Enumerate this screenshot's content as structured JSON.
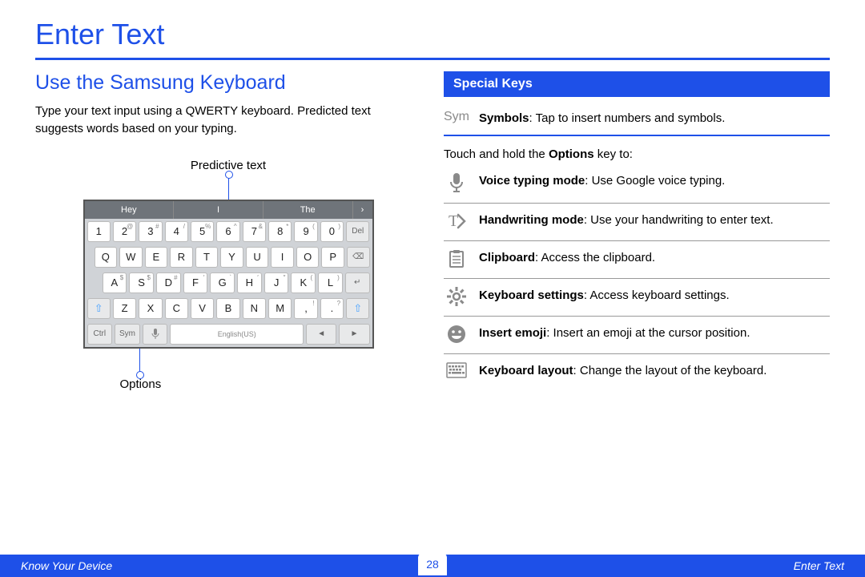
{
  "page_title": "Enter Text",
  "left": {
    "subtitle": "Use the Samsung Keyboard",
    "intro": "Type your text input using a QWERTY keyboard. Predicted text suggests words based on your typing.",
    "callout_top": "Predictive text",
    "callout_bottom": "Options",
    "predictions": [
      "Hey",
      "I",
      "The",
      "›"
    ],
    "row1": [
      {
        "main": "1",
        "sup": ""
      },
      {
        "main": "2",
        "sup": "@"
      },
      {
        "main": "3",
        "sup": "#"
      },
      {
        "main": "4",
        "sup": "/"
      },
      {
        "main": "5",
        "sup": "%"
      },
      {
        "main": "6",
        "sup": "^"
      },
      {
        "main": "7",
        "sup": "&"
      },
      {
        "main": "8",
        "sup": "*"
      },
      {
        "main": "9",
        "sup": "("
      },
      {
        "main": "0",
        "sup": ")"
      },
      {
        "main": "Del",
        "sup": ""
      }
    ],
    "row2": [
      {
        "main": "Q"
      },
      {
        "main": "W"
      },
      {
        "main": "E"
      },
      {
        "main": "R"
      },
      {
        "main": "T"
      },
      {
        "main": "Y"
      },
      {
        "main": "U"
      },
      {
        "main": "I"
      },
      {
        "main": "O"
      },
      {
        "main": "P"
      },
      {
        "main": "⌫"
      }
    ],
    "row3": [
      {
        "main": "A",
        "sup": "$"
      },
      {
        "main": "S",
        "sup": "$"
      },
      {
        "main": "D",
        "sup": "#"
      },
      {
        "main": "F",
        "sup": "′"
      },
      {
        "main": "G",
        "sup": "`"
      },
      {
        "main": "H",
        "sup": "′"
      },
      {
        "main": "J",
        "sup": "″"
      },
      {
        "main": "K",
        "sup": "("
      },
      {
        "main": "L",
        "sup": ")"
      },
      {
        "main": "↵"
      }
    ],
    "row4": [
      {
        "main": "⇧"
      },
      {
        "main": "Z"
      },
      {
        "main": "X"
      },
      {
        "main": "C"
      },
      {
        "main": "V"
      },
      {
        "main": "B"
      },
      {
        "main": "N"
      },
      {
        "main": "M"
      },
      {
        "main": ",",
        "sup": "!"
      },
      {
        "main": ".",
        "sup": "?"
      },
      {
        "main": "⇧"
      }
    ],
    "row5": {
      "ctrl": "Ctrl",
      "sym": "Sym",
      "mic": "🎤",
      "space": "English(US)",
      "left": "◄",
      "right": "►"
    }
  },
  "right": {
    "header": "Special Keys",
    "sym_row": {
      "icon": "Sym",
      "bold": "Symbols",
      "desc": ": Tap to insert numbers and symbols."
    },
    "intro": {
      "pre": "Touch and hold the ",
      "bold": "Options",
      "post": " key to:"
    },
    "items": [
      {
        "icon": "mic",
        "bold": "Voice typing mode",
        "desc": ": Use Google voice typing."
      },
      {
        "icon": "handwriting",
        "bold": "Handwriting mode",
        "desc": ": Use your handwriting to enter text."
      },
      {
        "icon": "clipboard",
        "bold": "Clipboard",
        "desc": ": Access the clipboard."
      },
      {
        "icon": "gear",
        "bold": "Keyboard settings",
        "desc": ": Access keyboard settings."
      },
      {
        "icon": "emoji",
        "bold": "Insert emoji",
        "desc": ": Insert an emoji at the cursor position."
      },
      {
        "icon": "layout",
        "bold": "Keyboard layout",
        "desc": ": Change the layout of the keyboard."
      }
    ]
  },
  "footer": {
    "left": "Know Your Device",
    "page": "28",
    "right": "Enter Text"
  }
}
